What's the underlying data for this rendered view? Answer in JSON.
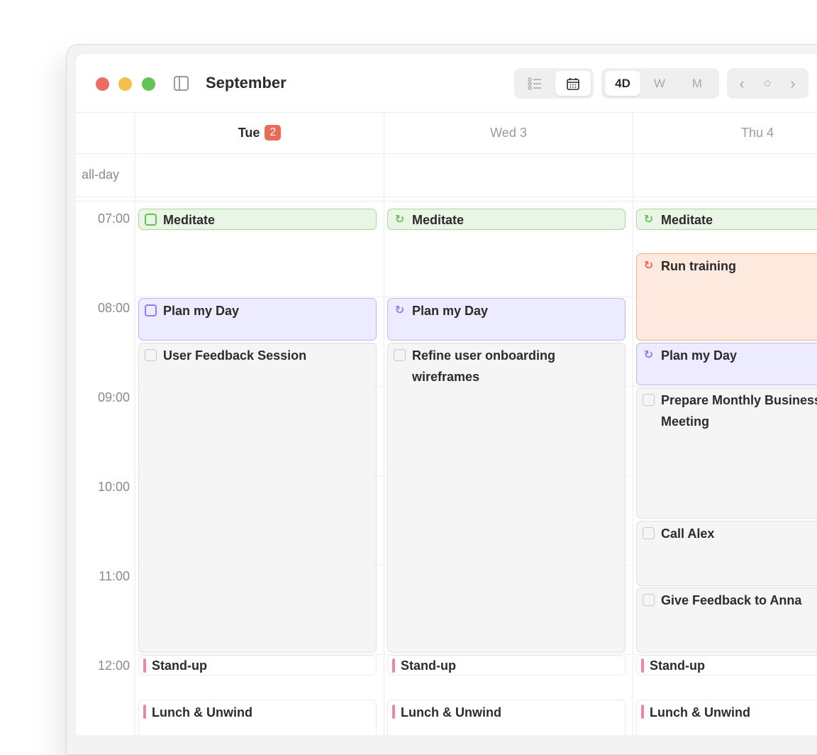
{
  "window": {
    "title": "September"
  },
  "toolbar": {
    "view_icons": [
      "list-icon",
      "calendar-icon"
    ],
    "ranges": [
      "4D",
      "W",
      "M"
    ],
    "nav": [
      "‹",
      "○",
      "›"
    ]
  },
  "colors": {
    "accent_red": "#e96b55",
    "green": "#61c454",
    "purple": "#8b7ef0",
    "orange": "#e96b55",
    "pink": "#e887a8"
  },
  "days": [
    {
      "label": "Tue",
      "badge": "2",
      "today": true
    },
    {
      "label": "Wed 3",
      "today": false
    },
    {
      "label": "Thu 4",
      "today": false
    }
  ],
  "allday_label": "all-day",
  "hours": [
    "07:00",
    "08:00",
    "09:00",
    "10:00",
    "11:00",
    "12:00"
  ],
  "events": {
    "tue": [
      {
        "title": "Meditate"
      },
      {
        "title": "Plan my Day"
      },
      {
        "title": "User Feedback Session"
      },
      {
        "title": "Stand-up"
      },
      {
        "title": "Lunch & Unwind"
      }
    ],
    "wed": [
      {
        "title": "Meditate"
      },
      {
        "title": "Plan my Day"
      },
      {
        "title": "Refine user onboarding wireframes"
      },
      {
        "title": "Stand-up"
      },
      {
        "title": "Lunch & Unwind"
      }
    ],
    "thu": [
      {
        "title": "Meditate"
      },
      {
        "title": "Run training"
      },
      {
        "title": "Plan my Day"
      },
      {
        "title": "Prepare Monthly Business Meeting"
      },
      {
        "title": "Call Alex"
      },
      {
        "title": "Give Feedback to Anna"
      },
      {
        "title": "Stand-up"
      },
      {
        "title": "Lunch & Unwind"
      }
    ]
  }
}
